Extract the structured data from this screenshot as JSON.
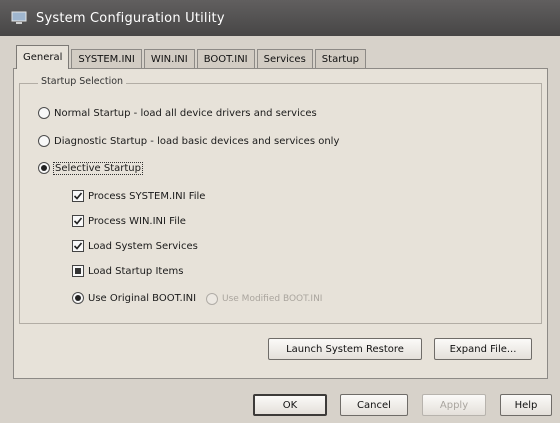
{
  "window": {
    "title": "System Configuration Utility"
  },
  "tabs": [
    {
      "label": "General",
      "active": true
    },
    {
      "label": "SYSTEM.INI",
      "active": false
    },
    {
      "label": "WIN.INI",
      "active": false
    },
    {
      "label": "BOOT.INI",
      "active": false
    },
    {
      "label": "Services",
      "active": false
    },
    {
      "label": "Startup",
      "active": false
    }
  ],
  "startup": {
    "legend": "Startup Selection",
    "normal": "Normal Startup - load all device drivers and services",
    "diagnostic": "Diagnostic Startup - load basic devices and services only",
    "selective": "Selective Startup",
    "options": {
      "process_system_ini": "Process SYSTEM.INI File",
      "process_win_ini": "Process WIN.INI File",
      "load_system_services": "Load System Services",
      "load_startup_items": "Load Startup Items"
    },
    "use_original_boot": "Use Original BOOT.INI",
    "use_modified_boot": "Use Modified BOOT.INI"
  },
  "buttons": {
    "launch_restore": "Launch System Restore",
    "expand_file": "Expand File...",
    "ok": "OK",
    "cancel": "Cancel",
    "apply": "Apply",
    "help": "Help"
  },
  "icons": {
    "title": "computer-icon"
  }
}
